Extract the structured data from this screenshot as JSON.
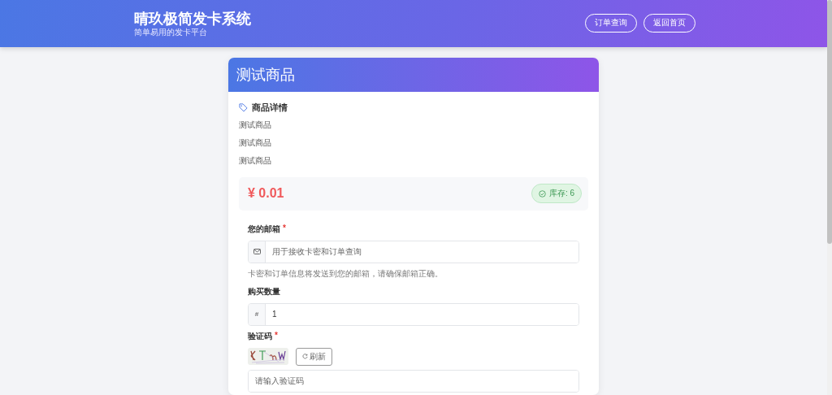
{
  "header": {
    "title": "晴玖极简发卡系统",
    "subtitle": "简单易用的发卡平台",
    "buttons": [
      "订单查询",
      "返回首页"
    ]
  },
  "product": {
    "title": "测试商品",
    "section_title": "商品详情",
    "description": [
      "测试商品",
      "测试商品",
      "测试商品"
    ],
    "price": "¥ 0.01",
    "stock": "库存: 6"
  },
  "form": {
    "required_mark": "*",
    "fields": [
      {
        "kind": "icon",
        "label": "您的邮箱",
        "required": true,
        "placeholder": "用于接收卡密和订单查询",
        "hint": "卡密和订单信息将发送到您的邮箱，请确保邮箱正确。"
      },
      {
        "kind": "prefix",
        "label": "购买数量",
        "required": false,
        "prefix": "#",
        "value": "1"
      },
      {
        "kind": "captcha",
        "label": "验证码",
        "required": true,
        "refresh": "刷新",
        "placeholder": "请输入验证码"
      }
    ]
  }
}
